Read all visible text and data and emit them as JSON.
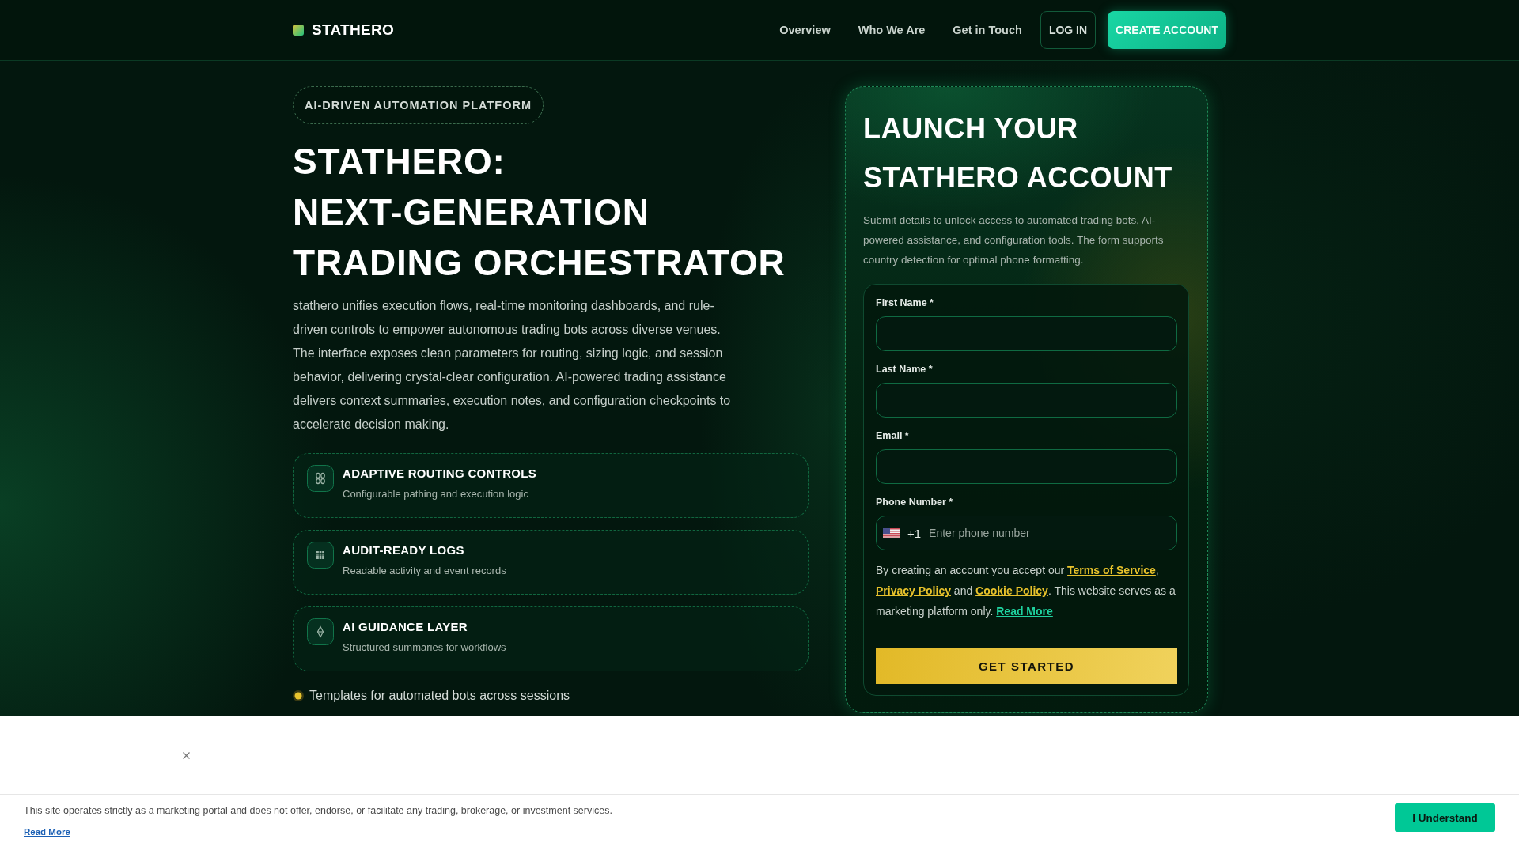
{
  "header": {
    "logo": "STATHERO",
    "nav": [
      "Overview",
      "Who We Are",
      "Get in Touch"
    ],
    "login_button": "LOG IN",
    "signup_button": "CREATE ACCOUNT"
  },
  "hero": {
    "badge": "AI-DRIVEN AUTOMATION PLATFORM",
    "title_lines": [
      "STATHERO:",
      "NEXT-GENERATION",
      "TRADING ORCHESTRATOR"
    ],
    "description": "stathero unifies execution flows, real-time monitoring dashboards, and rule-driven controls to empower autonomous trading bots across diverse venues. The interface exposes clean parameters for routing, sizing logic, and session behavior, delivering crystal-clear configuration. AI-powered trading assistance delivers context summaries, execution notes, and configuration checkpoints to accelerate decision making.",
    "features": [
      {
        "title": "ADAPTIVE ROUTING CONTROLS",
        "subtitle": "Configurable pathing and execution logic"
      },
      {
        "title": "AUDIT-READY LOGS",
        "subtitle": "Readable activity and event records"
      },
      {
        "title": "AI GUIDANCE LAYER",
        "subtitle": "Structured summaries for workflows"
      }
    ],
    "bullet": "Templates for automated bots across sessions"
  },
  "signup": {
    "title": "LAUNCH YOUR STATHERO ACCOUNT",
    "description": "Submit details to unlock access to automated trading bots, AI-powered assistance, and configuration tools. The form supports country detection for optimal phone formatting.",
    "fields": [
      {
        "kind": "input",
        "label": "First Name *"
      },
      {
        "kind": "input",
        "label": "Last Name *"
      },
      {
        "kind": "input",
        "label": "Email *"
      },
      {
        "kind": "phone",
        "label": "Phone Number *",
        "dial_code": "+1",
        "placeholder": "Enter phone number"
      }
    ],
    "consent": [
      {
        "kind": "text",
        "text": "By creating an account you accept our "
      },
      {
        "kind": "link",
        "text": "Terms of Service"
      },
      {
        "kind": "text",
        "text": ", "
      },
      {
        "kind": "link",
        "text": "Privacy Policy"
      },
      {
        "kind": "text",
        "text": " and "
      },
      {
        "kind": "link",
        "text": "Cookie Policy"
      },
      {
        "kind": "text",
        "text": ". This website serves as a marketing platform only. "
      },
      {
        "kind": "more_link",
        "text": "Read More"
      }
    ],
    "submit": "GET STARTED"
  },
  "cookie_banner": {
    "text": "This site operates strictly as a marketing portal and does not offer, endorse, or facilitate any trading, brokerage, or investment services.",
    "link": "Read More",
    "button": "I Understand"
  }
}
